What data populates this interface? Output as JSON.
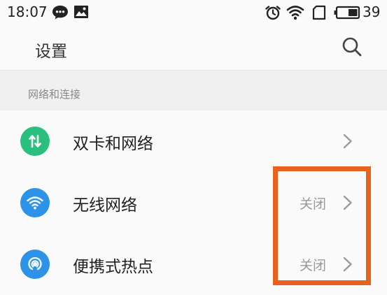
{
  "status_bar": {
    "time": "18:07",
    "battery_level": "39",
    "icons": [
      "chat-icon",
      "image-icon",
      "alarm-icon",
      "wifi-icon",
      "sim-card-icon",
      "battery-icon"
    ]
  },
  "header": {
    "title": "设置",
    "search_icon": "search-icon"
  },
  "section": {
    "title": "网络和连接"
  },
  "items": [
    {
      "label": "双卡和网络",
      "value": "",
      "icon": "dual-sim-icon",
      "icon_color": "#2bbf7f"
    },
    {
      "label": "无线网络",
      "value": "关闭",
      "icon": "wifi-icon",
      "icon_color": "#2c93e8"
    },
    {
      "label": "便携式热点",
      "value": "关闭",
      "icon": "hotspot-icon",
      "icon_color": "#2c93e8"
    }
  ],
  "colors": {
    "highlight": "#e8611f",
    "text_primary": "#222222",
    "text_secondary": "#999999"
  }
}
